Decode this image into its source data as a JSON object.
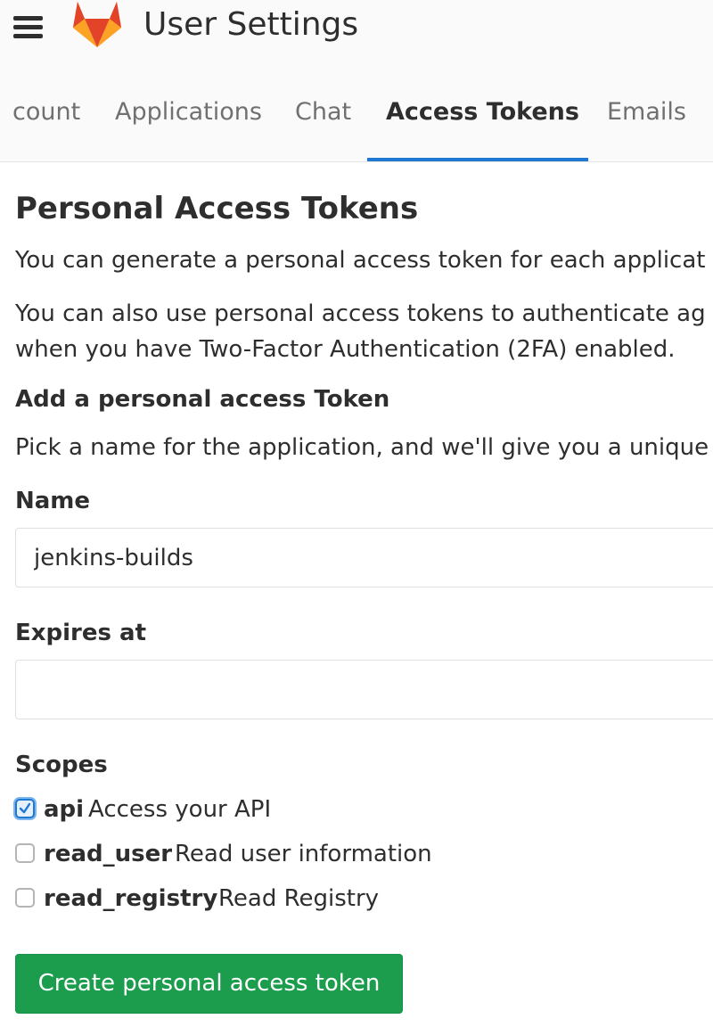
{
  "header": {
    "title": "User Settings",
    "menu_icon": "hamburger-menu-icon",
    "logo_icon": "gitlab-fox-logo"
  },
  "tabs": [
    {
      "label": "count",
      "active": false
    },
    {
      "label": "Applications",
      "active": false
    },
    {
      "label": "Chat",
      "active": false
    },
    {
      "label": "Access Tokens",
      "active": true
    },
    {
      "label": "Emails",
      "active": false
    }
  ],
  "main": {
    "heading": "Personal Access Tokens",
    "intro_1": "You can generate a personal access token for each applicat",
    "intro_2_line1": "You can also use personal access tokens to authenticate ag",
    "intro_2_line2": "when you have Two-Factor Authentication (2FA) enabled.",
    "subheading": "Add a personal access Token",
    "subheading_text": "Pick a name for the application, and we'll give you a unique"
  },
  "form": {
    "name_label": "Name",
    "name_value": "jenkins-builds",
    "expires_label": "Expires at",
    "expires_value": "",
    "scopes_label": "Scopes",
    "scopes": [
      {
        "name": "api",
        "description": "Access your API",
        "checked": true
      },
      {
        "name": "read_user",
        "description": "Read user information",
        "checked": false
      },
      {
        "name": "read_registry",
        "description": "Read Registry",
        "checked": false
      }
    ],
    "submit_label": "Create personal access token"
  },
  "colors": {
    "accent": "#1f78d1",
    "primary_button": "#1c9d4d",
    "text": "#2e2e2e",
    "muted_text": "#707070",
    "header_bg": "#fafafa"
  }
}
